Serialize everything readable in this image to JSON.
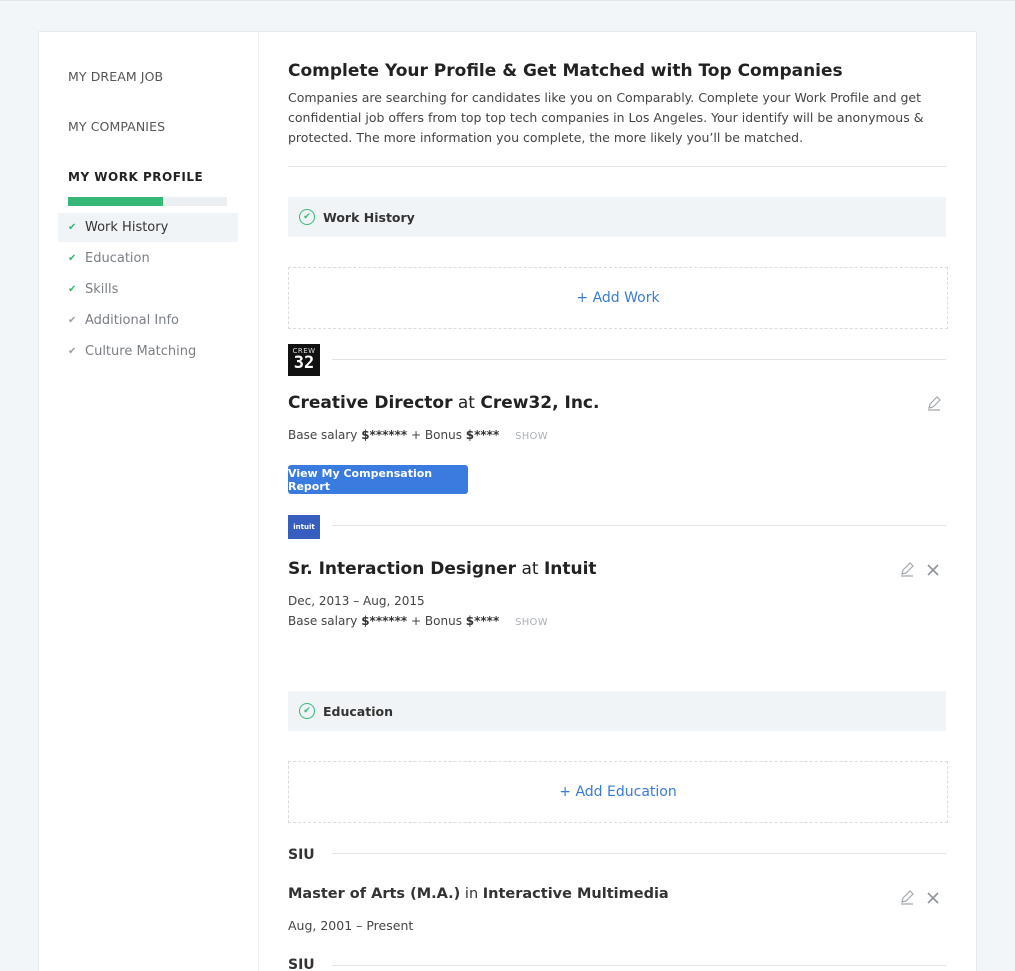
{
  "sidebar": {
    "links": [
      "MY DREAM JOB",
      "MY COMPANIES"
    ],
    "heading": "MY WORK PROFILE",
    "progress_fraction": 0.6,
    "items": [
      {
        "label": "Work History",
        "complete": true
      },
      {
        "label": "Education",
        "complete": true
      },
      {
        "label": "Skills",
        "complete": true
      },
      {
        "label": "Additional Info",
        "complete": false
      },
      {
        "label": "Culture Matching",
        "complete": false
      }
    ]
  },
  "main": {
    "title": "Complete Your Profile & Get Matched with Top Companies",
    "intro": "Companies are searching for candidates like you on Comparably. Complete your Work Profile and get confidential job offers from top top tech companies in Los Angeles. Your identify will be anonymous & protected. The more information you complete, the more likely you’ll be matched.",
    "work_section": "Work History",
    "add_work": "+ Add Work",
    "jobs": [
      {
        "logo_top": "CREW",
        "logo_num": "32",
        "role": "Creative Director",
        "at": "at",
        "company": "Crew32, Inc.",
        "base_label": "Base salary",
        "base_value": "$******",
        "bonus_label": "+ Bonus",
        "bonus_value": "$****",
        "show": "SHOW",
        "report_button": "View My Compensation Report"
      },
      {
        "logo_text": "intuit",
        "role": "Sr. Interaction Designer",
        "at": "at",
        "company": "Intuit",
        "dates": "Dec, 2013 – Aug, 2015",
        "base_label": "Base salary",
        "base_value": "$******",
        "bonus_label": "+ Bonus",
        "bonus_value": "$****",
        "show": "SHOW"
      }
    ],
    "education_section": "Education",
    "add_education": "+ Add Education",
    "education": [
      {
        "school": "SIU",
        "degree": "Master of Arts (M.A.)",
        "in": "in",
        "field": "Interactive Multimedia",
        "dates": "Aug, 2001 – Present"
      },
      {
        "school": "SIU"
      }
    ]
  },
  "colors": {
    "accent_blue": "#3a7be0",
    "success_green": "#35b877"
  },
  "icons": [
    "check-icon",
    "circle-check-icon",
    "pencil-icon",
    "close-icon"
  ]
}
